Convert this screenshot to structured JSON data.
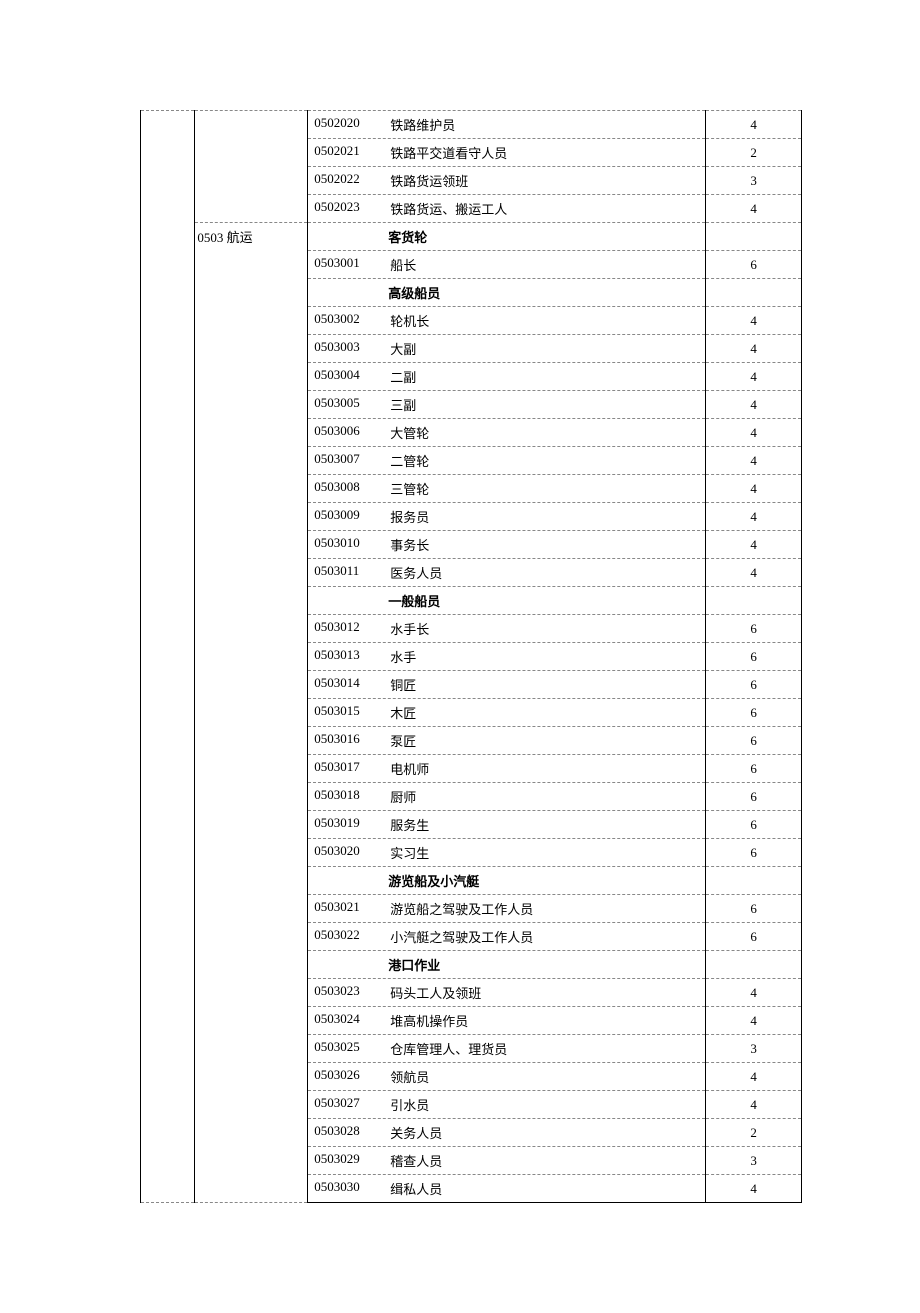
{
  "col1": "",
  "col2_initial": "",
  "category": "0503 航运",
  "rows": [
    {
      "type": "item",
      "code": "0502020",
      "desc": "铁路维护员",
      "val": "4"
    },
    {
      "type": "item",
      "code": "0502021",
      "desc": "铁路平交道看守人员",
      "val": "2"
    },
    {
      "type": "item",
      "code": "0502022",
      "desc": "铁路货运领班",
      "val": "3"
    },
    {
      "type": "item",
      "code": "0502023",
      "desc": "铁路货运、搬运工人",
      "val": "4"
    },
    {
      "type": "header",
      "label": "客货轮",
      "new_cat": true
    },
    {
      "type": "item",
      "code": "0503001",
      "desc": "船长",
      "val": "6"
    },
    {
      "type": "header",
      "label": "高级船员"
    },
    {
      "type": "item",
      "code": "0503002",
      "desc": "轮机长",
      "val": "4"
    },
    {
      "type": "item",
      "code": "0503003",
      "desc": "大副",
      "val": "4"
    },
    {
      "type": "item",
      "code": "0503004",
      "desc": "二副",
      "val": "4"
    },
    {
      "type": "item",
      "code": "0503005",
      "desc": "三副",
      "val": "4"
    },
    {
      "type": "item",
      "code": "0503006",
      "desc": "大管轮",
      "val": "4"
    },
    {
      "type": "item",
      "code": "0503007",
      "desc": "二管轮",
      "val": "4"
    },
    {
      "type": "item",
      "code": "0503008",
      "desc": "三管轮",
      "val": "4"
    },
    {
      "type": "item",
      "code": "0503009",
      "desc": "报务员",
      "val": "4"
    },
    {
      "type": "item",
      "code": "0503010",
      "desc": "事务长",
      "val": "4"
    },
    {
      "type": "item",
      "code": "0503011",
      "desc": "医务人员",
      "val": "4"
    },
    {
      "type": "header",
      "label": "一般船员"
    },
    {
      "type": "item",
      "code": "0503012",
      "desc": "水手长",
      "val": "6"
    },
    {
      "type": "item",
      "code": "0503013",
      "desc": "水手",
      "val": "6"
    },
    {
      "type": "item",
      "code": "0503014",
      "desc": "铜匠",
      "val": "6"
    },
    {
      "type": "item",
      "code": "0503015",
      "desc": "木匠",
      "val": "6"
    },
    {
      "type": "item",
      "code": "0503016",
      "desc": "泵匠",
      "val": "6"
    },
    {
      "type": "item",
      "code": "0503017",
      "desc": "电机师",
      "val": "6"
    },
    {
      "type": "item",
      "code": "0503018",
      "desc": "厨师",
      "val": "6"
    },
    {
      "type": "item",
      "code": "0503019",
      "desc": "服务生",
      "val": "6"
    },
    {
      "type": "item",
      "code": "0503020",
      "desc": "实习生",
      "val": "6"
    },
    {
      "type": "header",
      "label": "游览船及小汽艇"
    },
    {
      "type": "item",
      "code": "0503021",
      "desc": "游览船之驾驶及工作人员",
      "val": "6"
    },
    {
      "type": "item",
      "code": "0503022",
      "desc": "小汽艇之驾驶及工作人员",
      "val": "6"
    },
    {
      "type": "header",
      "label": "港口作业"
    },
    {
      "type": "item",
      "code": "0503023",
      "desc": "码头工人及领班",
      "val": "4"
    },
    {
      "type": "item",
      "code": "0503024",
      "desc": "堆高机操作员",
      "val": "4"
    },
    {
      "type": "item",
      "code": "0503025",
      "desc": "仓库管理人、理货员",
      "val": "3"
    },
    {
      "type": "item",
      "code": "0503026",
      "desc": "领航员",
      "val": "4"
    },
    {
      "type": "item",
      "code": "0503027",
      "desc": "引水员",
      "val": "4"
    },
    {
      "type": "item",
      "code": "0503028",
      "desc": "关务人员",
      "val": "2"
    },
    {
      "type": "item",
      "code": "0503029",
      "desc": "稽查人员",
      "val": "3"
    },
    {
      "type": "item",
      "code": "0503030",
      "desc": "缉私人员",
      "val": "4"
    }
  ]
}
